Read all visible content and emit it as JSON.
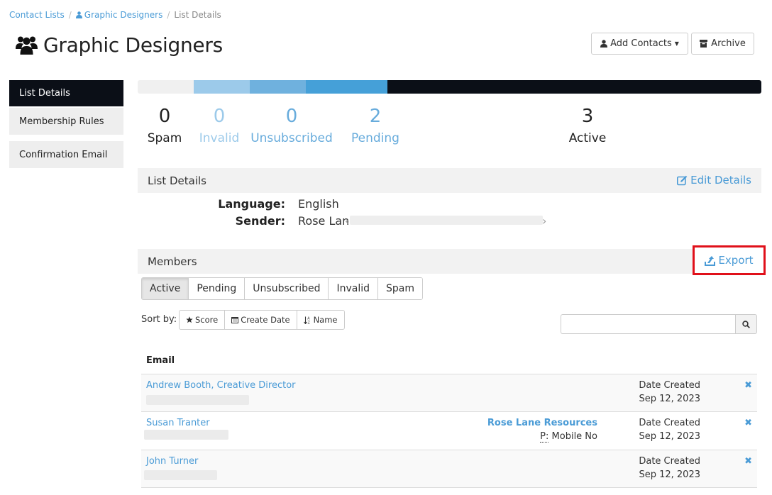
{
  "breadcrumb": {
    "items": [
      {
        "label": "Contact Lists"
      },
      {
        "label": "Graphic Designers"
      },
      {
        "label": "List Details"
      }
    ],
    "separator": "/"
  },
  "header": {
    "title": "Graphic Designers",
    "icon": "users-icon",
    "add_contacts_label": "Add Contacts",
    "archive_label": "Archive"
  },
  "sidebar": {
    "items": [
      {
        "label": "List Details",
        "active": true
      },
      {
        "label": "Membership Rules",
        "active": false
      },
      {
        "label": "Confirmation Email",
        "active": false
      }
    ]
  },
  "progress": {
    "segments": [
      {
        "name": "Spam",
        "fraction": 0.09,
        "color": "#f0f0f0"
      },
      {
        "name": "Invalid",
        "fraction": 0.09,
        "color": "#9ccaea"
      },
      {
        "name": "Unsubscribed",
        "fraction": 0.09,
        "color": "#6fb1de"
      },
      {
        "name": "Pending",
        "fraction": 0.13,
        "color": "#45a0d8"
      },
      {
        "name": "Active",
        "fraction": 0.6,
        "color": "#0b0f17"
      }
    ]
  },
  "stats": [
    {
      "value": "0",
      "label": "Spam"
    },
    {
      "value": "0",
      "label": "Invalid"
    },
    {
      "value": "0",
      "label": "Unsubscribed"
    },
    {
      "value": "2",
      "label": "Pending"
    },
    {
      "value": "3",
      "label": "Active"
    }
  ],
  "list_details": {
    "title": "List Details",
    "edit_label": "Edit Details",
    "language_key": "Language:",
    "language_value": "English",
    "sender_key": "Sender:",
    "sender_value": "Rose Lane",
    "sender_open": "‹",
    "sender_close": "›"
  },
  "members": {
    "title": "Members",
    "export_label": "Export",
    "tabs": [
      {
        "label": "Active",
        "active": true
      },
      {
        "label": "Pending",
        "active": false
      },
      {
        "label": "Unsubscribed",
        "active": false
      },
      {
        "label": "Invalid",
        "active": false
      },
      {
        "label": "Spam",
        "active": false
      }
    ],
    "sort_label": "Sort by:",
    "sort_options": [
      {
        "label": "Score",
        "icon": "star-icon"
      },
      {
        "label": "Create Date",
        "icon": "calendar-icon"
      },
      {
        "label": "Name",
        "icon": "sort-alpha-icon"
      }
    ],
    "search_placeholder": "",
    "column_header": "Email",
    "rows": [
      {
        "name": "Andrew Booth, Creative Director",
        "company": "",
        "phone_prefix": "",
        "phone_value": "",
        "date_label": "Date Created",
        "date": "Sep 12, 2023"
      },
      {
        "name": "Susan Tranter",
        "company": "Rose Lane Resources",
        "phone_prefix": "P:",
        "phone_value": "Mobile No",
        "date_label": "Date Created",
        "date": "Sep 12, 2023"
      },
      {
        "name": "John Turner",
        "company": "",
        "phone_prefix": "",
        "phone_value": "",
        "date_label": "Date Created",
        "date": "Sep 12, 2023"
      }
    ]
  },
  "colors": {
    "accent": "#4a9bd6",
    "dark": "#0b0f17",
    "highlight": "#e0101a"
  }
}
